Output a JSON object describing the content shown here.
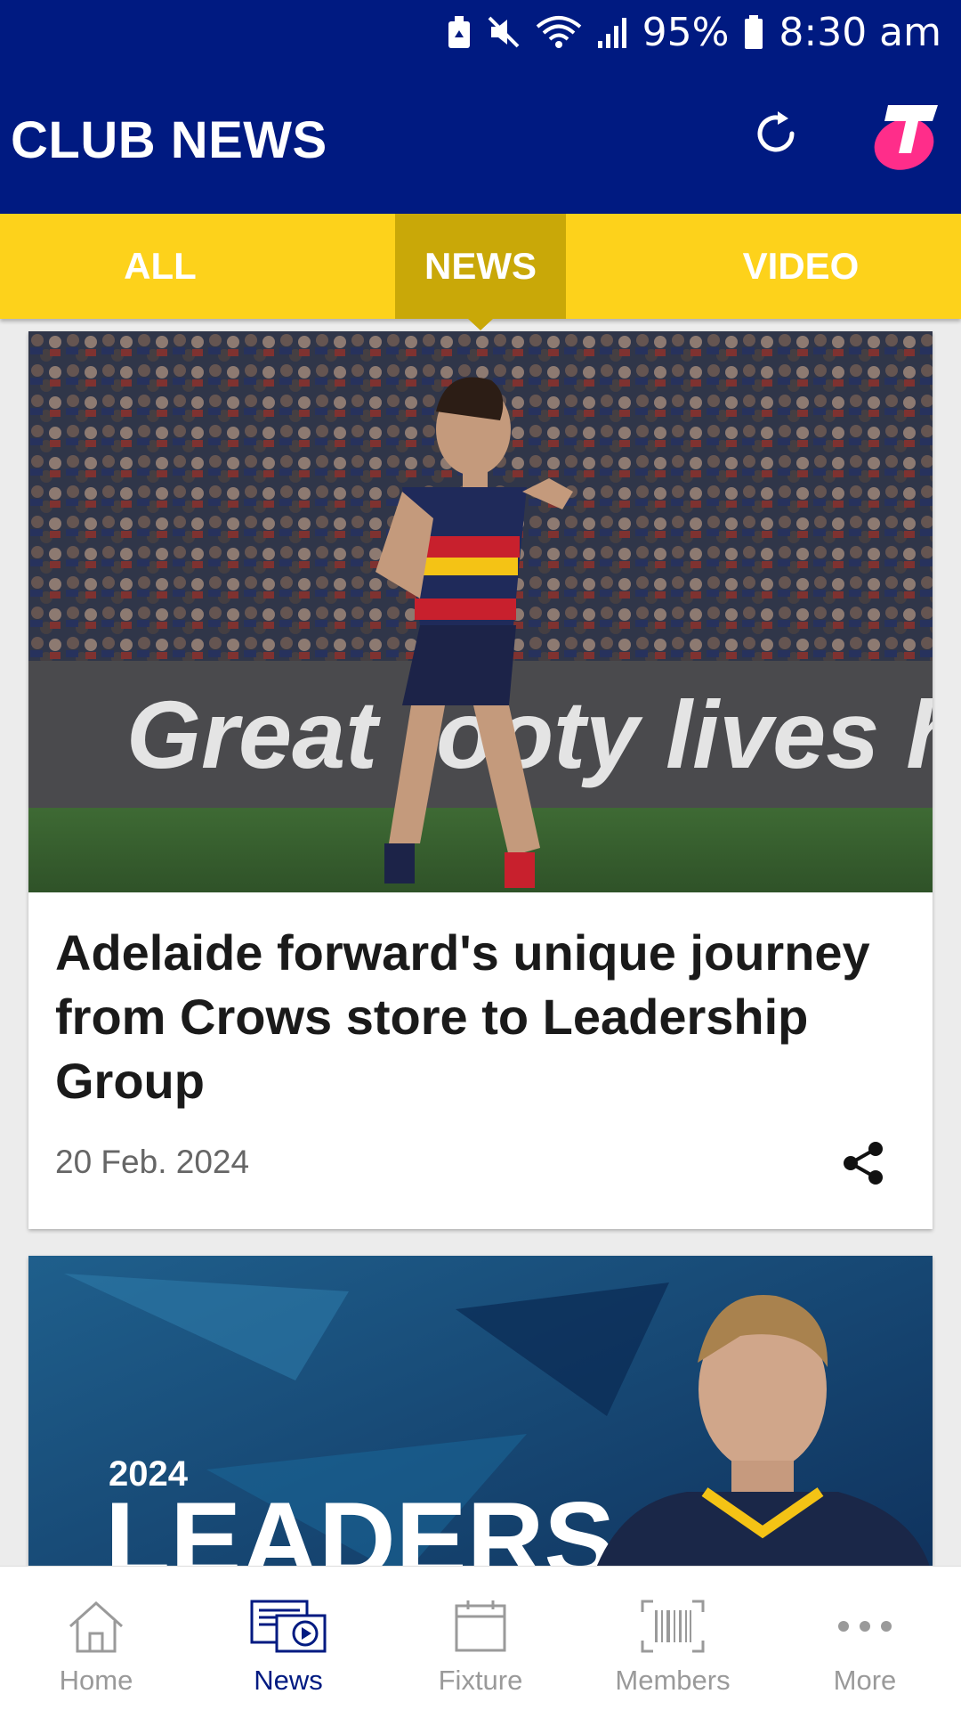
{
  "status_bar": {
    "battery": "95%",
    "time": "8:30 am"
  },
  "header": {
    "title": "CLUB NEWS"
  },
  "tabs": [
    {
      "label": "ALL",
      "active": false
    },
    {
      "label": "NEWS",
      "active": true
    },
    {
      "label": "VIDEO",
      "active": false
    }
  ],
  "articles": [
    {
      "image_banner": "Great footy lives here.",
      "headline": "Adelaide forward's unique journey from Crows store to Leadership Group",
      "date": "20 Feb. 2024"
    },
    {
      "image_year": "2024",
      "image_word": "LEADERS"
    }
  ],
  "bottom_nav": [
    {
      "label": "Home",
      "icon": "home-icon"
    },
    {
      "label": "News",
      "icon": "news-icon",
      "active": true
    },
    {
      "label": "Fixture",
      "icon": "calendar-icon"
    },
    {
      "label": "Members",
      "icon": "barcode-icon"
    },
    {
      "label": "More",
      "icon": "more-dots-icon"
    }
  ],
  "colors": {
    "header_bg": "#001a81",
    "tab_bg": "#fdd21b",
    "tab_active_bg": "#c9a808",
    "brand_pink": "#ff2d8a"
  }
}
